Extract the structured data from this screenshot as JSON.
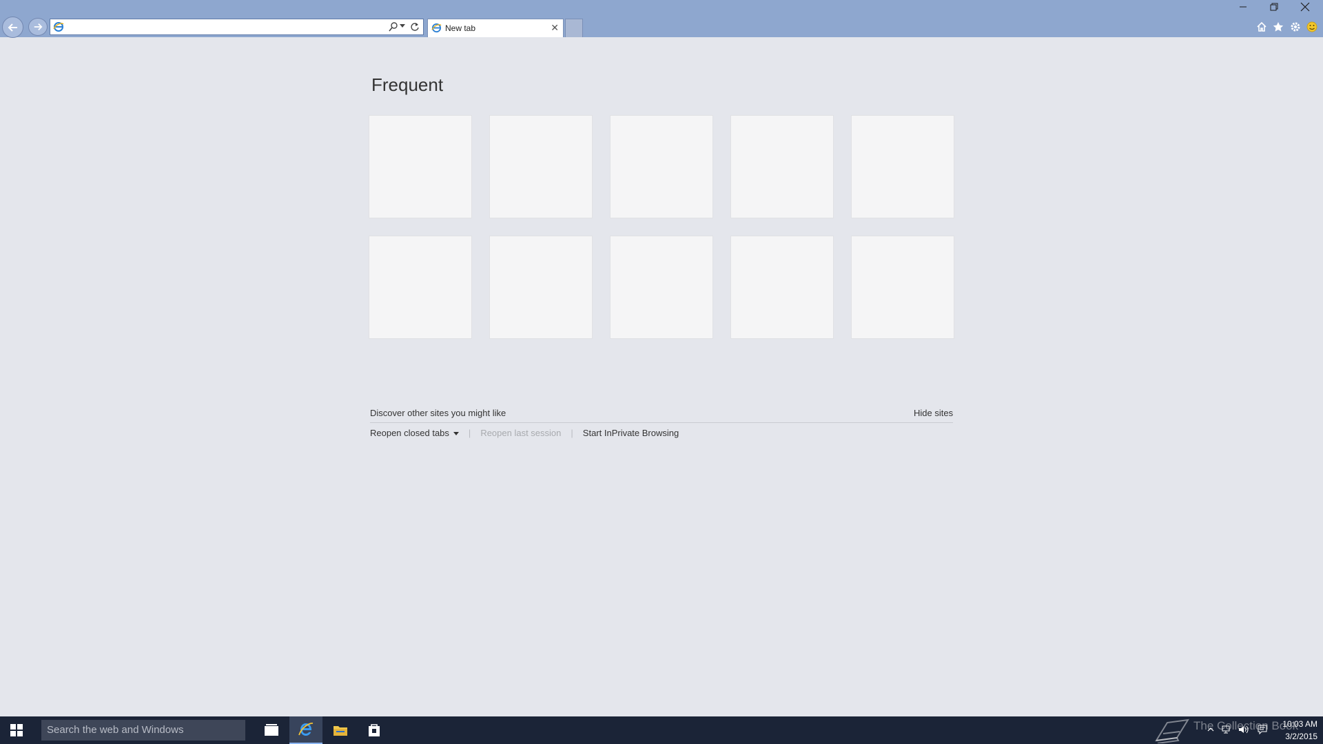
{
  "window": {
    "addressbar": {
      "value": ""
    },
    "tab": {
      "label": "New tab"
    }
  },
  "page": {
    "frequent_title": "Frequent",
    "tile_count": 10,
    "discover_text": "Discover other sites you might like",
    "hide_sites": "Hide sites",
    "reopen_closed_tabs": "Reopen closed tabs",
    "reopen_last_session": "Reopen last session",
    "start_inprivate": "Start InPrivate Browsing"
  },
  "taskbar": {
    "search_placeholder": "Search the web and Windows",
    "watermark": "The Collection Book",
    "time": "10:03 AM",
    "date": "3/2/2015"
  },
  "colors": {
    "titlebar": "#8ea7cf",
    "page_bg": "#e4e6ec",
    "tile_bg": "#f5f5f6",
    "taskbar": "#1b2437"
  }
}
